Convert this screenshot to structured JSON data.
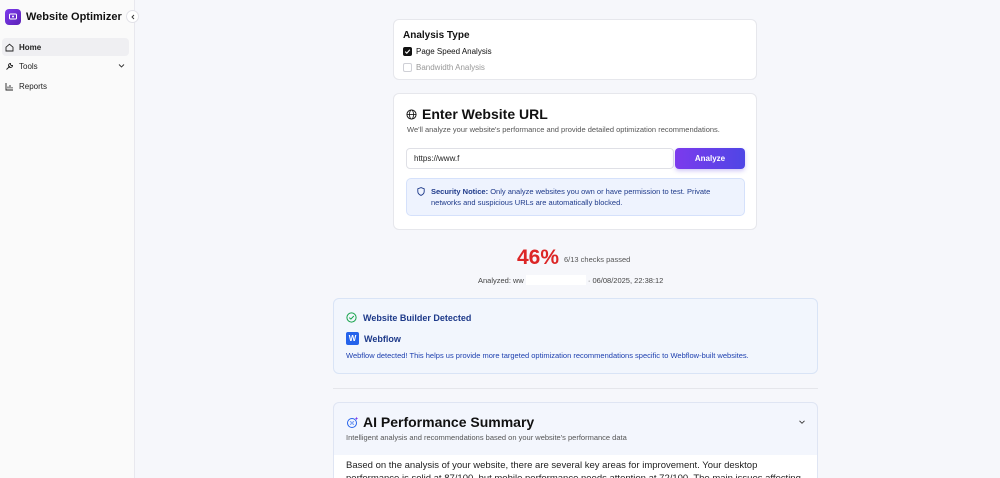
{
  "app": {
    "title": "Website Optimizer"
  },
  "sidebar": {
    "items": [
      {
        "label": "Home",
        "icon": "home-icon",
        "active": true
      },
      {
        "label": "Tools",
        "icon": "wrench-icon",
        "active": false
      },
      {
        "label": "Reports",
        "icon": "chart-icon",
        "active": false
      }
    ]
  },
  "analysis_type": {
    "heading": "Analysis Type",
    "options": [
      {
        "label": "Page Speed Analysis",
        "checked": true
      },
      {
        "label": "Bandwidth Analysis",
        "checked": false
      }
    ]
  },
  "url_card": {
    "title": "Enter Website URL",
    "subtitle": "We'll analyze your website's performance and provide detailed optimization recommendations.",
    "input_value": "https://www.f",
    "button_label": "Analyze",
    "notice_label": "Security Notice:",
    "notice_text": "Only analyze websites you own or have permission to test. Private networks and suspicious URLs are automatically blocked."
  },
  "score": {
    "percent": "46%",
    "checks": "6/13 checks passed",
    "analyzed_prefix": "Analyzed: ww",
    "analyzed_suffix": "· 06/08/2025, 22:38:12"
  },
  "builder": {
    "heading": "Website Builder Detected",
    "logo_letter": "W",
    "name": "Webflow",
    "description": "Webflow detected! This helps us provide more targeted optimization recommendations specific to Webflow-built websites."
  },
  "ai_summary": {
    "title": "AI Performance Summary",
    "subtitle": "Intelligent analysis and recommendations based on your website's performance data",
    "body": "Based on the analysis of your website, there are several key areas for improvement. Your desktop performance is solid at 87/100, but mobile performance needs attention at 72/100. The main issues affecting your Core Web Vitals"
  },
  "colors": {
    "accent": "#7c3aed",
    "score": "#dc2626",
    "notice_bg": "#eef3fe"
  }
}
